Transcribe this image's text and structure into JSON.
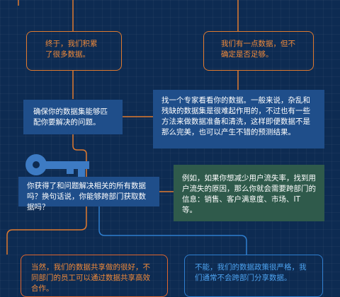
{
  "boxes": {
    "top_left": "终于，我们积累了很多数据。",
    "top_right": "我们有一点数据，但不确定是否足够。",
    "check_data": "确保你的数据集能够匹配你要解决的问题。",
    "expert": "找一个专家看看你的数据。一般来说，杂乱和残缺的数据集是很难起作用的，不过也有一些方法来做数据准备和清洗，这样即便数据不是那么完美，也可以产生不错的预测结果。",
    "access": "你获得了和问题解决相关的所有数据吗？换句话说，你能够跨部门获取数据吗？",
    "example": "例如，如果你想减少用户流失率，找到用户流失的原因，那么你就会需要跨部门的信息：销售、客户满意度、市场、IT 等。",
    "yes_share": "当然，我们的数据共享做的很好，不同部门的员工可以通过数据共享高效合作。",
    "no_share": "不能，我们的数据政策很严格，我们通常不会跨部门分享数据。"
  },
  "colors": {
    "background": "#0d2b52",
    "orange_line": "#e07a2e",
    "blue_line": "#2f7fd0",
    "blue_fill": "#1f4e8a",
    "green_fill": "#2f5a4b",
    "key": "#3d7bc4"
  },
  "icons": [
    "key-icon"
  ]
}
